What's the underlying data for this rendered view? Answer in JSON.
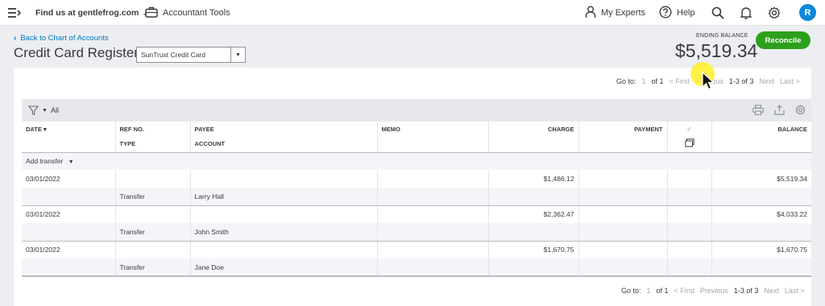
{
  "topbar": {
    "company": "Find us at gentlefrog.com",
    "accountant_tools": "Accountant Tools",
    "my_experts": "My Experts",
    "help": "Help",
    "avatar_initial": "R"
  },
  "header": {
    "back_link": "Back to Chart of Accounts",
    "title": "Credit Card Register",
    "account_select": "SunTrust Credit Card",
    "ending_balance_label": "ENDING BALANCE",
    "ending_balance": "$5,519.34",
    "reconcile": "Reconcile"
  },
  "pager": {
    "goto": "Go to:",
    "page": "1",
    "of": "of 1",
    "first": "< First",
    "previous": "Previous",
    "range": "1-3 of 3",
    "next": "Next",
    "last": "Last >"
  },
  "filter": {
    "label": "All"
  },
  "columns": {
    "date": "DATE",
    "ref": "REF NO.",
    "type": "TYPE",
    "payee": "PAYEE",
    "account": "ACCOUNT",
    "memo": "MEMO",
    "charge": "CHARGE",
    "payment": "PAYMENT",
    "balance": "BALANCE"
  },
  "add_transfer": "Add transfer",
  "rows": [
    {
      "date": "03/01/2022",
      "type": "Transfer",
      "payee": "Larry Hall",
      "charge": "$1,486.12",
      "balance": "$5,519.34"
    },
    {
      "date": "03/01/2022",
      "type": "Transfer",
      "payee": "John Smith",
      "charge": "$2,362.47",
      "balance": "$4,033.22"
    },
    {
      "date": "03/01/2022",
      "type": "Transfer",
      "payee": "Jane Doe",
      "charge": "$1,670.75",
      "balance": "$1,670.75"
    }
  ],
  "colors": {
    "accent": "#0077c5",
    "reconcile": "#2ca01c",
    "avatar": "#0d88dd"
  }
}
